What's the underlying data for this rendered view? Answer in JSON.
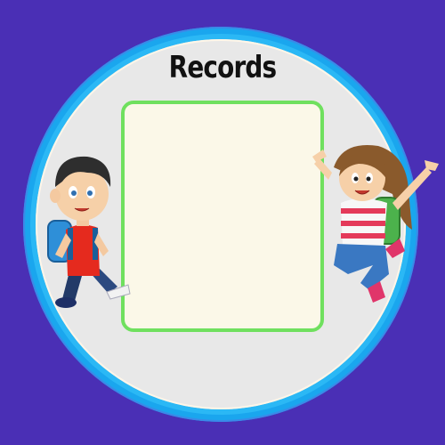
{
  "screen": {
    "title": "Records"
  },
  "colors": {
    "background": "#4a2fb5",
    "ring": "#1aa6ee",
    "panel_fill": "#fbf8e8",
    "panel_border": "#6fe05e"
  },
  "characters": {
    "left": "boy-with-backpack",
    "right": "girl-with-backpack"
  }
}
